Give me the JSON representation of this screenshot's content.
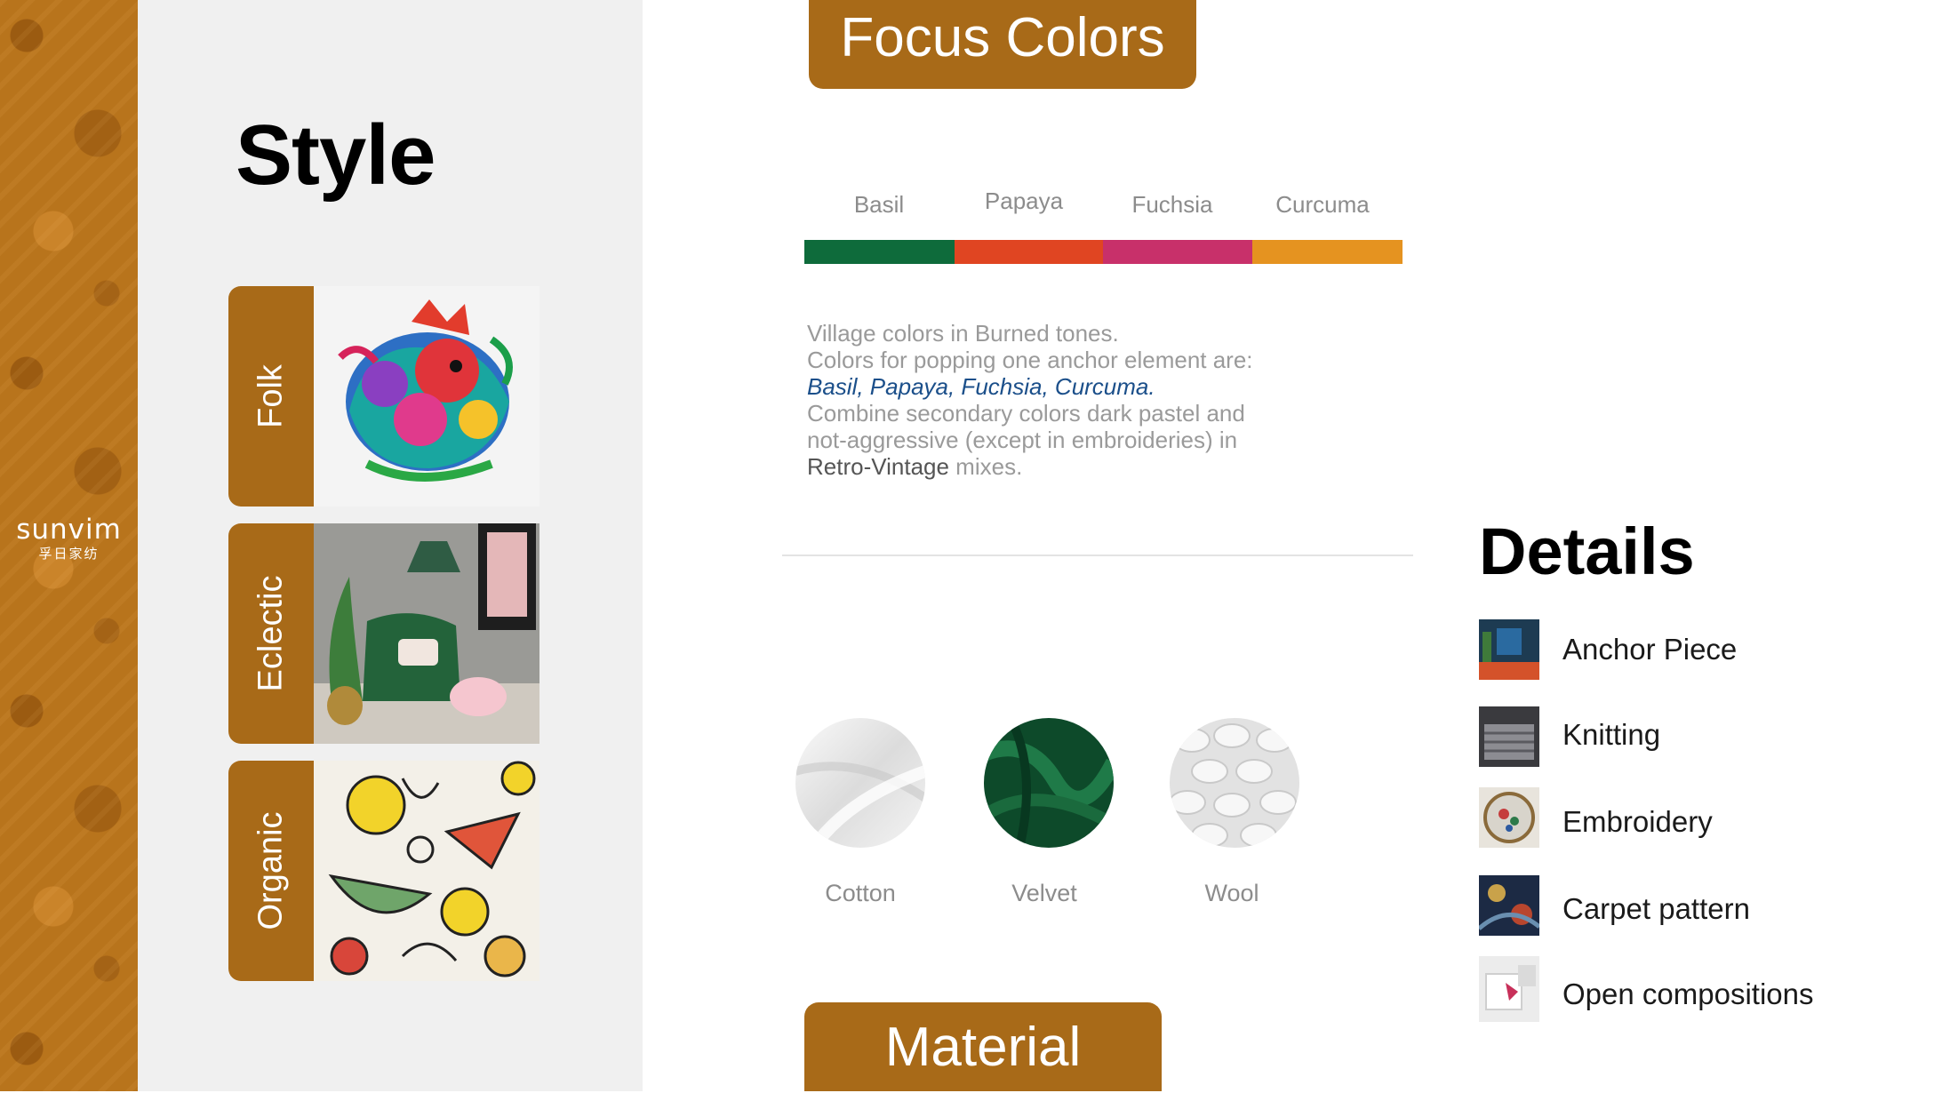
{
  "brand": {
    "name": "sunvim",
    "subtitle": "孚日家纺"
  },
  "style_section": {
    "title": "Style",
    "cards": [
      {
        "label": "Folk",
        "image": "paper-cut-rooster-art"
      },
      {
        "label": "Eclectic",
        "image": "green-velvet-armchair-interior"
      },
      {
        "label": "Organic",
        "image": "fruit-pattern-print"
      }
    ]
  },
  "focus_colors": {
    "header": "Focus Colors",
    "swatches": [
      {
        "name": "Basil",
        "color": "#0e6b3b"
      },
      {
        "name": "Papaya",
        "color": "#e04522"
      },
      {
        "name": "Fuchsia",
        "color": "#c8306a"
      },
      {
        "name": "Curcuma",
        "color": "#e59320"
      }
    ],
    "description": {
      "line1": "Village colors in Burned tones.",
      "line2": "Colors for popping one anchor element are:",
      "line3": "Basil, Papaya, Fuchsia, Curcuma.",
      "line4": "Combine secondary colors dark pastel and",
      "line5": "not-aggressive (except in embroideries) in",
      "line6_highlight": "Retro-Vintage",
      "line6_rest": " mixes."
    }
  },
  "materials": {
    "header": "Material",
    "items": [
      {
        "label": "Cotton",
        "image": "white-cotton-fabric"
      },
      {
        "label": "Velvet",
        "image": "green-velvet-fabric"
      },
      {
        "label": "Wool",
        "image": "chunky-knit-wool"
      }
    ]
  },
  "details": {
    "title": "Details",
    "items": [
      {
        "label": "Anchor Piece",
        "image": "anchor-piece-thumb"
      },
      {
        "label": "Knitting",
        "image": "knitting-thumb"
      },
      {
        "label": "Embroidery",
        "image": "embroidery-hoop-thumb"
      },
      {
        "label": "Carpet pattern",
        "image": "carpet-pattern-thumb"
      },
      {
        "label": "Open compositions",
        "image": "open-composition-thumb"
      }
    ]
  }
}
